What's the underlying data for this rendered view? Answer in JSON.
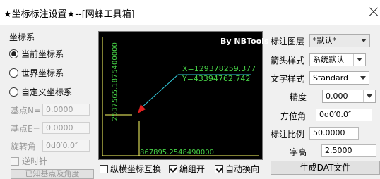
{
  "window": {
    "title": "★坐标标注设置★--[网蜂工具箱]"
  },
  "coord_group": {
    "title": "坐标系",
    "options": [
      "当前坐标系",
      "世界坐标系",
      "自定义坐标系"
    ],
    "selected_index": 0,
    "base_n": {
      "label": "基点N=",
      "value": "0.0000"
    },
    "base_e": {
      "label": "基点E=",
      "value": "0.0000"
    },
    "rotation": {
      "label": "旋转角",
      "value": "0d0′0.0″"
    },
    "counterclockwise": {
      "label": "逆时针",
      "checked": false
    },
    "bottom_button": "已知基点及角度"
  },
  "preview": {
    "brand": "By NBTools",
    "x_label": "X=129378259.377",
    "y_label": "Y=43394762.742",
    "vertical_value": "2537565.1875400000",
    "horizontal_value": "867895.2548490000",
    "colors": {
      "background": "#000000",
      "text_green": "#46d246",
      "lines": "#ffff66",
      "leader": "#33ccdd",
      "arrow": "#e02020",
      "brand": "#ffffff"
    }
  },
  "bottom_checks": [
    {
      "label": "纵横坐标互换",
      "checked": false
    },
    {
      "label": "编组开",
      "checked": true
    },
    {
      "label": "自动换向",
      "checked": true
    }
  ],
  "settings": {
    "layer": {
      "label": "标注图层",
      "value": "*默认*"
    },
    "arrow_style": {
      "label": "箭头样式",
      "value": "系统默认"
    },
    "text_style": {
      "label": "文字样式",
      "value": "Standard"
    },
    "precision": {
      "label": "精度",
      "value": "0.000"
    },
    "azimuth": {
      "label": "方位角",
      "value": "0d0′0.0″"
    },
    "scale": {
      "label": "标注比例",
      "value": "50.0000"
    },
    "text_height": {
      "label": "字高",
      "value": "2.5000"
    },
    "generate_button": "生成DAT文件"
  }
}
